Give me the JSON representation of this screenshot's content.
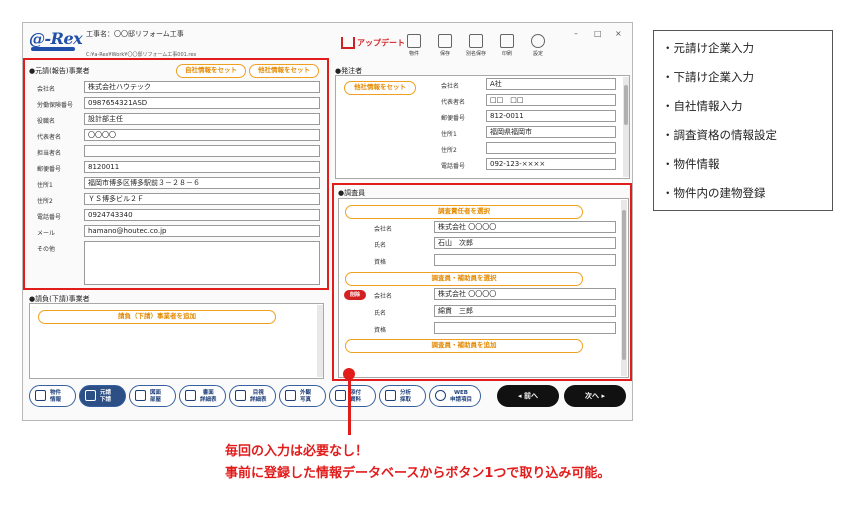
{
  "app": {
    "logo": "@-Rex",
    "project_title": "工事名：〇〇邸リフォーム工事",
    "project_path": "C:¥a-Rex¥Work¥〇〇邸リフォーム工事001.rex",
    "window_controls": {
      "minimize": "–",
      "maximize": "□",
      "close": "×"
    }
  },
  "toolbar": {
    "update_label": "アップデート",
    "buttons": [
      {
        "label": "物件",
        "icon": "folder-icon"
      },
      {
        "label": "保存",
        "icon": "save-icon"
      },
      {
        "label": "別名保存",
        "icon": "save-as-icon"
      },
      {
        "label": "印刷",
        "icon": "printer-icon"
      },
      {
        "label": "設定",
        "icon": "gear-icon"
      }
    ]
  },
  "contractor": {
    "title": "●元請(報告)事業者",
    "own_btn": "自社情報をセット",
    "other_btn": "他社情報をセット",
    "fields": [
      {
        "label": "会社名",
        "value": "株式会社ハウテック"
      },
      {
        "label": "労働保険番号",
        "value": "0987654321ASD"
      },
      {
        "label": "役職名",
        "value": "設計部主任"
      },
      {
        "label": "代表者名",
        "value": "〇〇〇〇"
      },
      {
        "label": "担当者名",
        "value": ""
      },
      {
        "label": "郵便番号",
        "value": "8120011"
      },
      {
        "label": "住所1",
        "value": "福岡市博多区博多駅前３－２８－６"
      },
      {
        "label": "住所2",
        "value": "ＹＳ博多ビル２Ｆ"
      },
      {
        "label": "電話番号",
        "value": "0924743340"
      },
      {
        "label": "メール",
        "value": "hamano@houtec.co.jp"
      },
      {
        "label": "その他",
        "value": ""
      }
    ]
  },
  "subcontractor": {
    "title": "●請負(下請)事業者",
    "add_btn": "請負（下請）事業者を追加"
  },
  "orderer": {
    "title": "●発注者",
    "other_btn": "他社情報をセット",
    "fields": [
      {
        "label": "会社名",
        "value": "A社"
      },
      {
        "label": "代表者名",
        "value": "□□　□□"
      },
      {
        "label": "郵便番号",
        "value": "812-0011"
      },
      {
        "label": "住所1",
        "value": "福岡県福岡市"
      },
      {
        "label": "住所2",
        "value": ""
      },
      {
        "label": "電話番号",
        "value": "092-123-××××"
      }
    ]
  },
  "surveyor": {
    "title": "●調査員",
    "select_lead_btn": "調査責任者を選択",
    "lead_fields": [
      {
        "label": "会社名",
        "value": "株式会社 〇〇〇〇"
      },
      {
        "label": "氏名",
        "value": "石山　次郎"
      },
      {
        "label": "資格",
        "value": ""
      }
    ],
    "select_assist_btn": "調査員・補助員を選択",
    "delete_badge": "削除",
    "assist_fields": [
      {
        "label": "会社名",
        "value": "株式会社 〇〇〇〇"
      },
      {
        "label": "氏名",
        "value": "綿貫　三郎"
      },
      {
        "label": "資格",
        "value": ""
      }
    ],
    "add_assist_btn": "調査員・補助員を追加"
  },
  "bottom_nav": {
    "buttons": [
      {
        "line1": "物件",
        "line2": "情報",
        "icon": "building-icon"
      },
      {
        "line1": "元請",
        "line2": "下請",
        "icon": "people-icon"
      },
      {
        "line1": "図面",
        "line2": "部屋",
        "icon": "blueprint-icon"
      },
      {
        "line1": "書面",
        "line2": "詳細表",
        "icon": "document-icon"
      },
      {
        "line1": "目視",
        "line2": "詳細表",
        "icon": "magnifier-icon"
      },
      {
        "line1": "外観",
        "line2": "写真",
        "icon": "house-icon"
      },
      {
        "line1": "添付",
        "line2": "資料",
        "icon": "clip-icon"
      },
      {
        "line1": "分析",
        "line2": "採取",
        "icon": "flask-icon"
      },
      {
        "line1": "WEB",
        "line2": "申請項目",
        "icon": "globe-icon"
      }
    ],
    "prev": "◂ 前へ",
    "next": "次へ ▸"
  },
  "task_list": [
    "・元請け企業入力",
    "・下請け企業入力",
    "・自社情報入力",
    "・調査資格の情報設定",
    "・物件情報",
    "・物件内の建物登録"
  ],
  "caption": {
    "line1": "毎回の入力は必要なし！",
    "line2": "事前に登録した情報データベースからボタン1つで取り込み可能。"
  },
  "colors": {
    "accent_red": "#e21b1b",
    "orange": "#f0a020",
    "navy": "#1e3f78"
  }
}
